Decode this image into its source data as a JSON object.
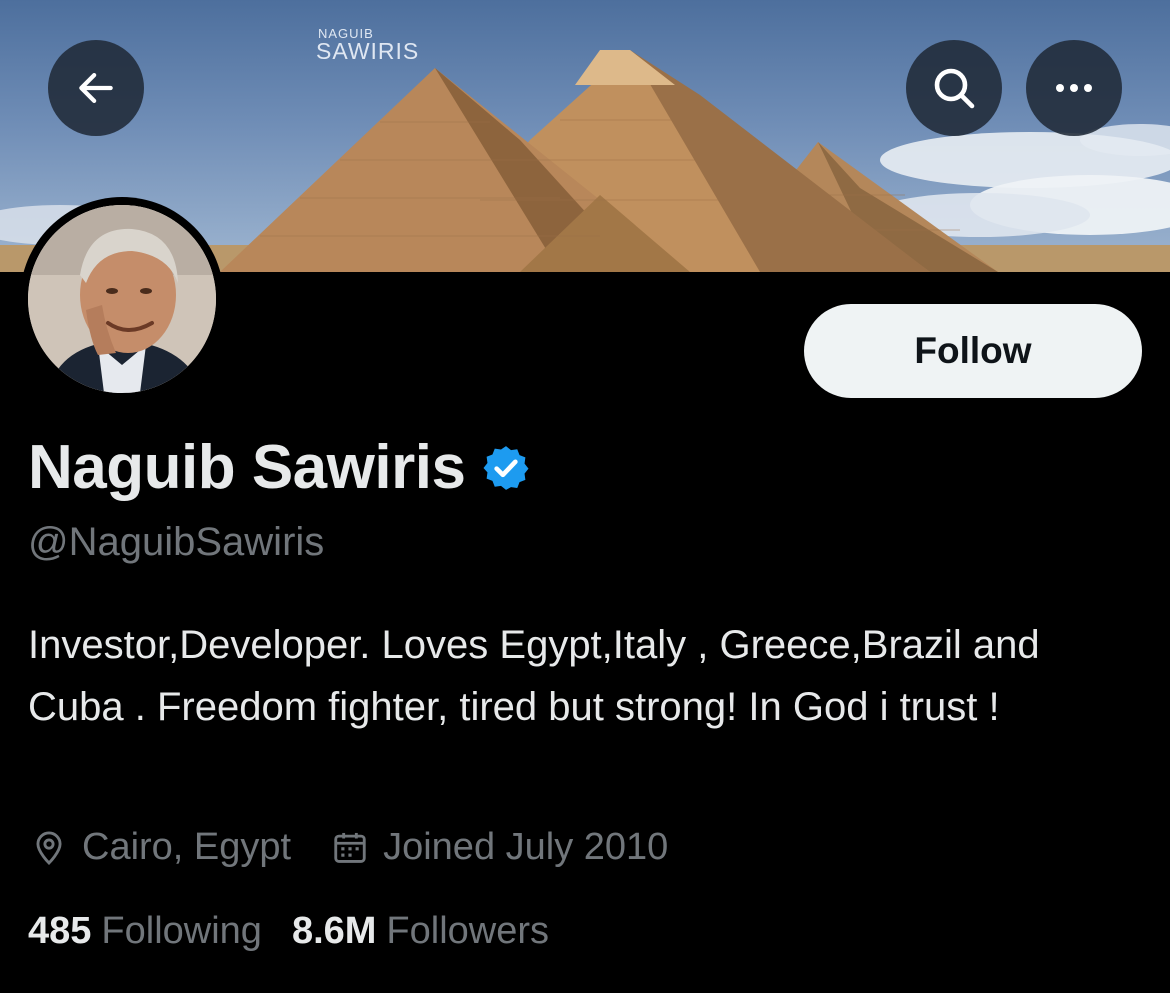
{
  "banner": {
    "logo_line1": "NAGUIB",
    "logo_line2": "SAWIRIS"
  },
  "header": {
    "back_icon": "arrow-left-icon",
    "search_icon": "search-icon",
    "more_icon": "more-horizontal-icon"
  },
  "profile": {
    "display_name": "Naguib Sawiris",
    "handle": "@NaguibSawiris",
    "verified": true,
    "bio": "Investor,Developer. Loves Egypt,Italy , Greece,Brazil and Cuba . Freedom fighter, tired but strong! In God i trust !",
    "location": "Cairo, Egypt",
    "joined": "Joined July 2010",
    "follow_label": "Follow"
  },
  "stats": {
    "following_count": "485",
    "following_label": "Following",
    "followers_count": "8.6M",
    "followers_label": "Followers"
  },
  "colors": {
    "background": "#000000",
    "verified": "#1d9bf0",
    "secondary_text": "#71767b",
    "follow_bg": "#eff3f4"
  }
}
